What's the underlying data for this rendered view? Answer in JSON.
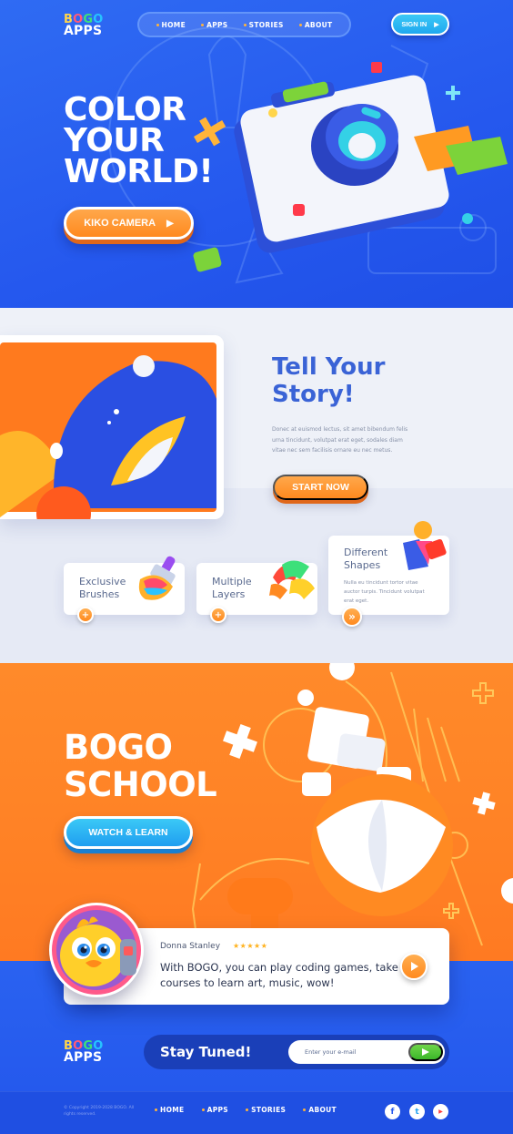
{
  "brand": {
    "logo_top": [
      "B",
      "O",
      "G",
      "O"
    ],
    "logo_top_colors": [
      "#ffd54a",
      "#ff5a7a",
      "#3ee07a",
      "#27c3ff"
    ],
    "logo_bottom": "APPS"
  },
  "nav": {
    "items": [
      "HOME",
      "APPS",
      "STORIES",
      "ABOUT"
    ],
    "signin_label": "SIGN IN"
  },
  "hero": {
    "title_lines": [
      "COLOR",
      "YOUR",
      "WORLD!"
    ],
    "cta_label": "KIKO CAMERA"
  },
  "story": {
    "title_lines": [
      "Tell Your",
      "Story!"
    ],
    "body": "Donec at euismod lectus, sit amet bibendum felis urna tincidunt, volutpat erat eget, sodales diam vitae nec sem facilisis ornare eu nec metus.",
    "cta_label": "START NOW",
    "features": [
      {
        "title_lines": [
          "Exclusive",
          "Brushes"
        ],
        "icon": "brush-icon",
        "button": "+"
      },
      {
        "title_lines": [
          "Multiple",
          "Layers"
        ],
        "icon": "layers-icon",
        "button": "+"
      },
      {
        "title_lines": [
          "Different",
          "Shapes"
        ],
        "icon": "shapes-icon",
        "desc": "Nulla eu tincidunt tortor vitae auctor turpis. Tincidunt volutpat erat eget.",
        "button": "»"
      }
    ]
  },
  "school": {
    "title_lines": [
      "BOGO",
      "SCHOOL"
    ],
    "cta_label": "WATCH & LEARN"
  },
  "testimonial": {
    "name": "Donna Stanley",
    "stars": "★★★★★",
    "quote": "With BOGO, you can play coding games, take courses to learn art, music, wow!"
  },
  "newsletter": {
    "heading": "Stay Tuned!",
    "placeholder": "Enter your e-mail"
  },
  "footer": {
    "copyright": "© Copyright 2019-2028 BOGO. All rights reserved.",
    "nav_items": [
      "HOME",
      "APPS",
      "STORIES",
      "ABOUT"
    ],
    "social": [
      "f",
      "t",
      "▶"
    ],
    "social_icons": [
      "facebook-icon",
      "twitter-icon",
      "youtube-icon"
    ]
  },
  "colors": {
    "blue": "#2558ee",
    "orange": "#ff8a1f",
    "cyan": "#27c3ff",
    "green": "#3cb82a",
    "light": "#eef1f8"
  }
}
